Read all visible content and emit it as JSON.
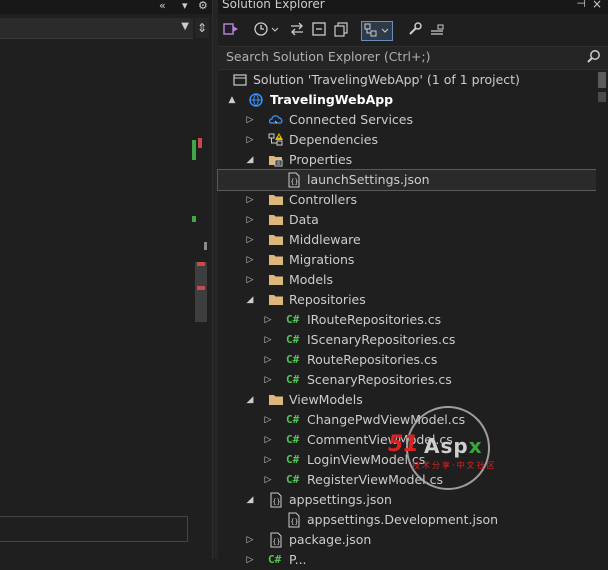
{
  "left": {
    "top_controls": [
      "«",
      "▾",
      "⚙"
    ],
    "split_glyph": "⇕"
  },
  "solution_explorer": {
    "title": "Solution Explorer",
    "pin_glyph": "⊣",
    "close_glyph": "×",
    "search_placeholder": "Search Solution Explorer (Ctrl+;)",
    "tree": [
      {
        "label": "Solution 'TravelingWebApp' (1 of 1 project)",
        "icon": "solution-icon",
        "expander": "",
        "indent": 0
      },
      {
        "label": "TravelingWebApp",
        "icon": "web-project-icon",
        "expander": "▲",
        "indent": 0,
        "bold": true
      },
      {
        "label": "Connected Services",
        "icon": "connected-services-icon",
        "expander": "▷",
        "indent": 1
      },
      {
        "label": "Dependencies",
        "icon": "dependencies-icon",
        "expander": "▷",
        "indent": 1
      },
      {
        "label": "Properties",
        "icon": "properties-folder-icon",
        "expander": "◢",
        "indent": 1
      },
      {
        "label": "launchSettings.json",
        "icon": "json-file-icon",
        "expander": "",
        "indent": 2,
        "selected": true
      },
      {
        "label": "Controllers",
        "icon": "folder-icon",
        "expander": "▷",
        "indent": 1
      },
      {
        "label": "Data",
        "icon": "folder-icon",
        "expander": "▷",
        "indent": 1
      },
      {
        "label": "Middleware",
        "icon": "folder-icon",
        "expander": "▷",
        "indent": 1
      },
      {
        "label": "Migrations",
        "icon": "folder-icon",
        "expander": "▷",
        "indent": 1
      },
      {
        "label": "Models",
        "icon": "folder-icon",
        "expander": "▷",
        "indent": 1
      },
      {
        "label": "Repositories",
        "icon": "folder-icon",
        "expander": "◢",
        "indent": 1
      },
      {
        "label": "IRouteRepositories.cs",
        "icon": "csharp-file-icon",
        "expander": "▷",
        "indent": 2
      },
      {
        "label": "IScenaryRepositories.cs",
        "icon": "csharp-file-icon",
        "expander": "▷",
        "indent": 2
      },
      {
        "label": "RouteRepositories.cs",
        "icon": "csharp-file-icon",
        "expander": "▷",
        "indent": 2
      },
      {
        "label": "ScenaryRepositories.cs",
        "icon": "csharp-file-icon",
        "expander": "▷",
        "indent": 2
      },
      {
        "label": "ViewModels",
        "icon": "folder-icon",
        "expander": "◢",
        "indent": 1
      },
      {
        "label": "ChangePwdViewModel.cs",
        "icon": "csharp-file-icon",
        "expander": "▷",
        "indent": 2
      },
      {
        "label": "CommentViewModel.cs",
        "icon": "csharp-file-icon",
        "expander": "▷",
        "indent": 2
      },
      {
        "label": "LoginViewModel.cs",
        "icon": "csharp-file-icon",
        "expander": "▷",
        "indent": 2
      },
      {
        "label": "RegisterViewModel.cs",
        "icon": "csharp-file-icon",
        "expander": "▷",
        "indent": 2
      },
      {
        "label": "appsettings.json",
        "icon": "json-file-icon",
        "expander": "◢",
        "indent": 1
      },
      {
        "label": "appsettings.Development.json",
        "icon": "json-file-icon",
        "expander": "",
        "indent": 2
      },
      {
        "label": "package.json",
        "icon": "json-file-icon",
        "expander": "▷",
        "indent": 1
      },
      {
        "label": "P...",
        "icon": "csharp-file-icon",
        "expander": "▷",
        "indent": 1
      }
    ]
  },
  "watermark": {
    "brand_red": "51",
    "brand_grey": "Asp",
    "brand_x": "x",
    "tagline": "技术分享·中文社区"
  },
  "colors": {
    "background": "#1f1f1f",
    "folder": "#dcb67a",
    "csharp": "#4ec94e",
    "accent": "#3794ff"
  }
}
